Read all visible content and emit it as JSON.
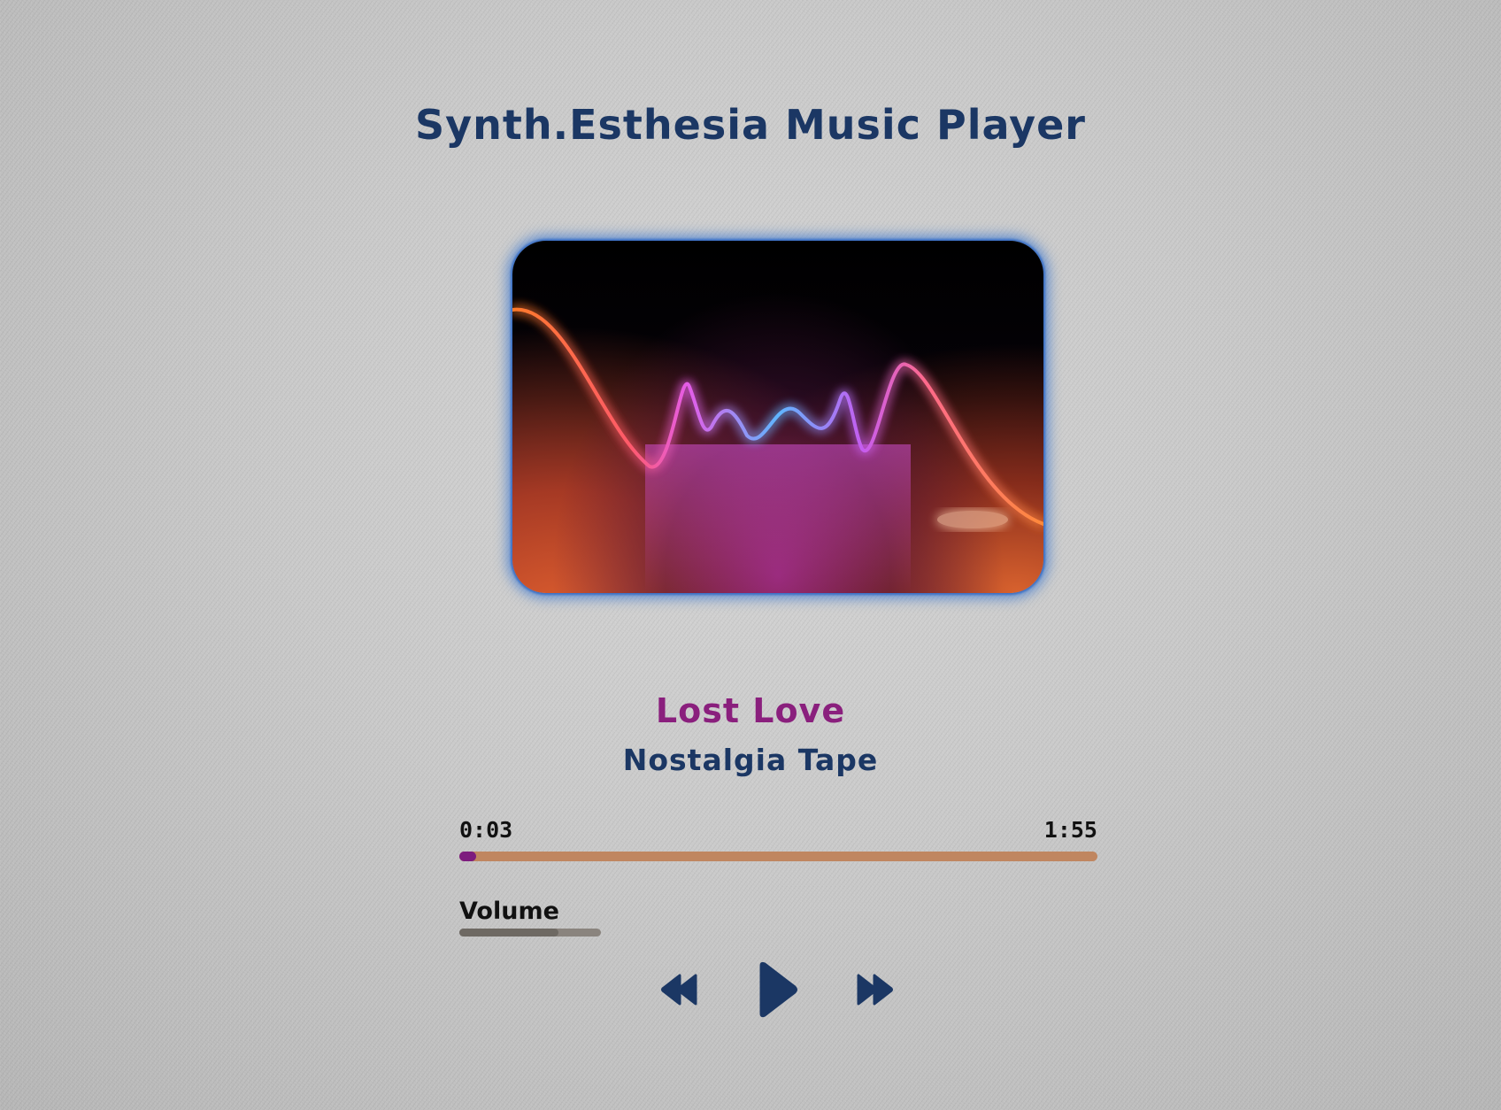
{
  "app": {
    "title": "Synth.Esthesia Music Player"
  },
  "track": {
    "title": "Lost Love",
    "artist": "Nostalgia Tape"
  },
  "progress": {
    "current_time": "0:03",
    "total_time": "1:55",
    "fraction": 0.026
  },
  "volume": {
    "label": "Volume",
    "fraction": 0.7
  },
  "controls": {
    "rewind_icon": "rewind-icon",
    "play_icon": "play-icon",
    "forward_icon": "fast-forward-icon"
  },
  "colors": {
    "title": "#1b3764",
    "song_title": "#8a1f7d",
    "progress_track": "#c08660",
    "progress_fill": "#7d1c7e",
    "controls": "#1b3764",
    "art_glow": "#3c78d2"
  }
}
